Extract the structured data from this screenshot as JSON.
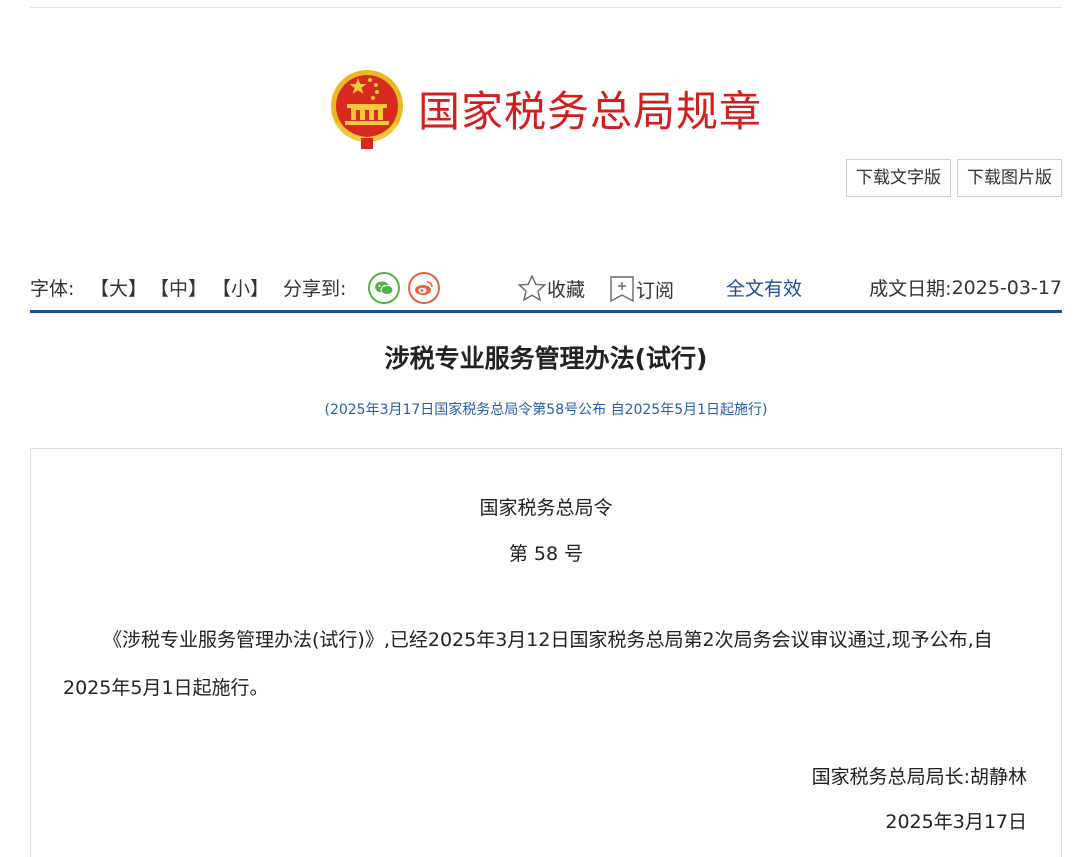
{
  "header": {
    "site_title": "国家税务总局规章",
    "download_text_label": "下载文字版",
    "download_image_label": "下载图片版"
  },
  "toolbar": {
    "font_label": "字体:",
    "size_large": "【大】",
    "size_medium": "【中】",
    "size_small": "【小】",
    "share_label": "分享到:",
    "favorite_label": "收藏",
    "subscribe_label": "订阅",
    "validity": "全文有效",
    "date_label": "成文日期:",
    "date_value": "2025-03-17"
  },
  "document": {
    "title": "涉税专业服务管理办法(试行)",
    "subtitle": "(2025年3月17日国家税务总局令第58号公布 自2025年5月1日起施行)",
    "order_heading": "国家税务总局令",
    "order_number": "第 58 号",
    "body_paragraph": "《涉税专业服务管理办法(试行)》,已经2025年3月12日国家税务总局第2次局务会议审议通过,现予公布,自2025年5月1日起施行。",
    "signature": "国家税务总局局长:胡静林",
    "signature_date": "2025年3月17日"
  },
  "colors": {
    "brand_red": "#d41e1e",
    "rule_blue": "#1d4e93",
    "link_blue": "#2a5caa",
    "wechat_green": "#56b04a",
    "weibo_orange": "#e8603c"
  },
  "icons": [
    "national-emblem-icon",
    "wechat-icon",
    "weibo-icon",
    "star-icon",
    "bookmark-icon"
  ]
}
